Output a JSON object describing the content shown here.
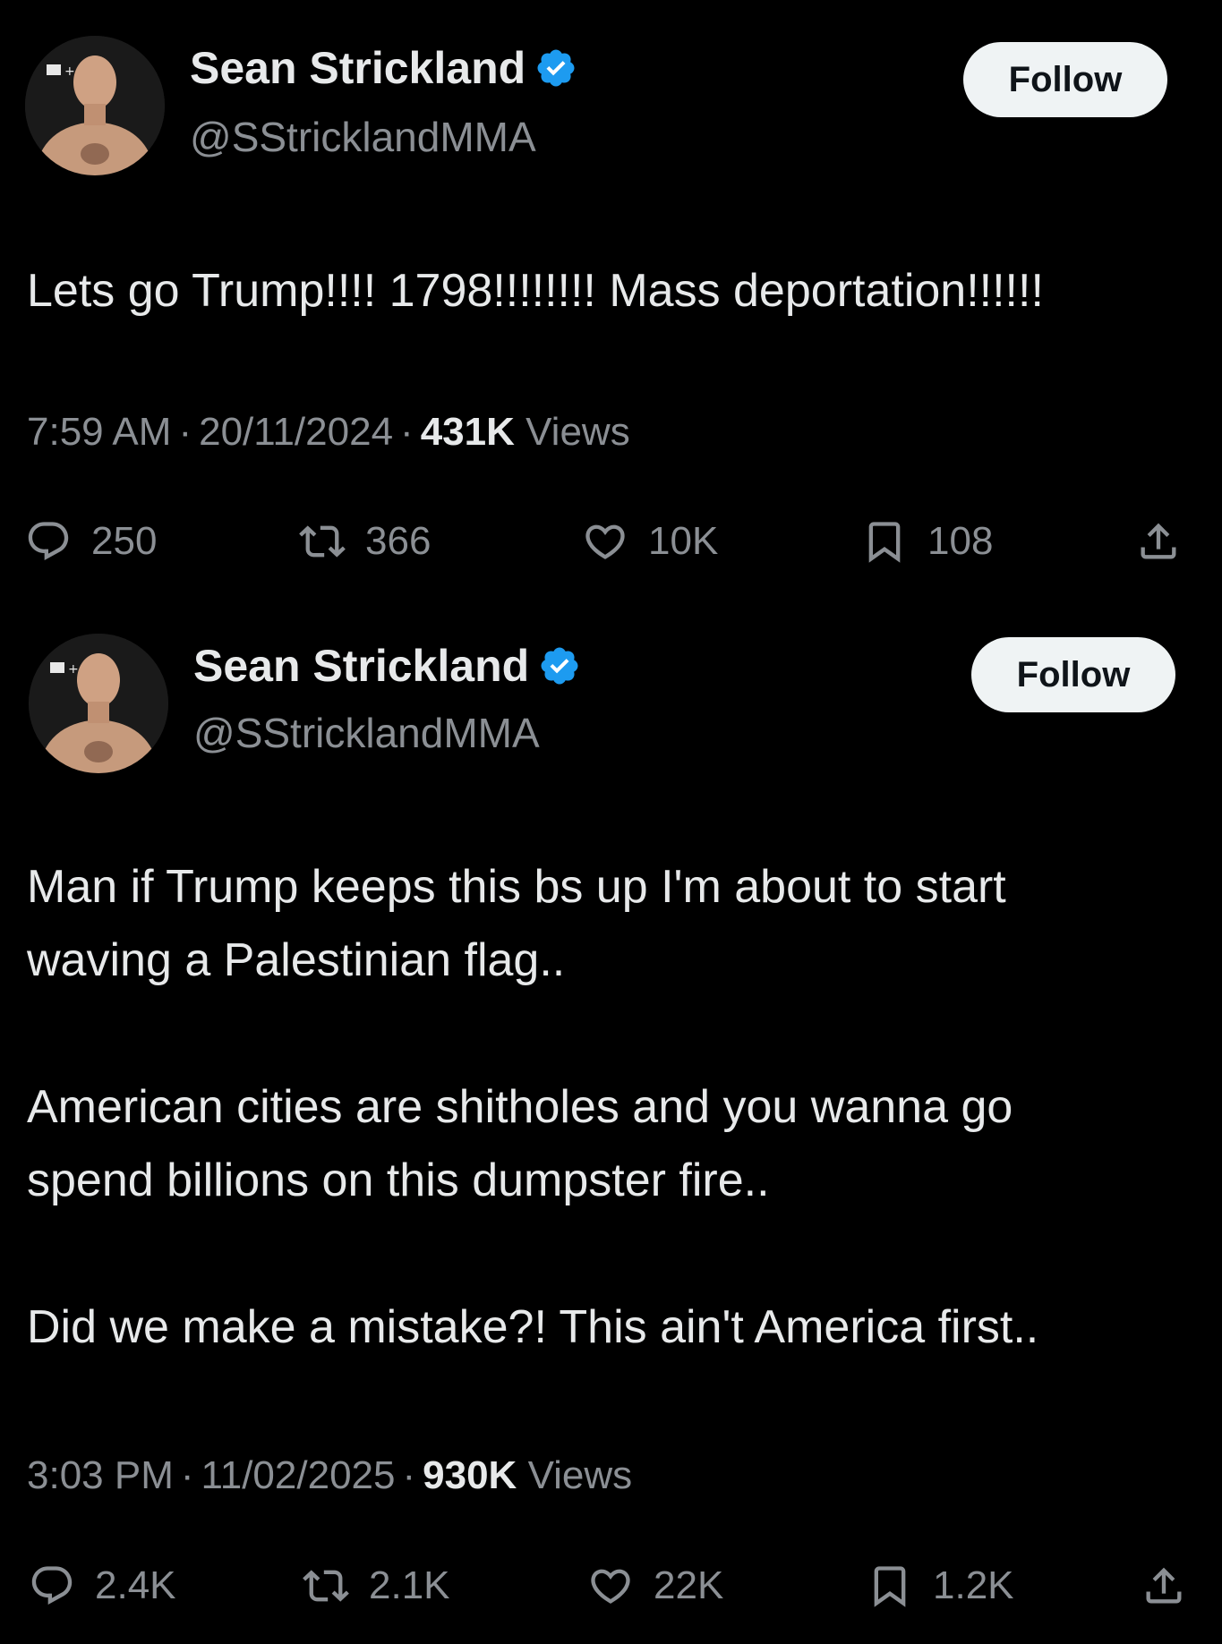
{
  "tweets": [
    {
      "author": {
        "display_name": "Sean Strickland",
        "handle": "@SStricklandMMA",
        "verified": true
      },
      "follow_label": "Follow",
      "text": [
        "Lets go Trump!!!! 1798!!!!!!!! Mass deportation!!!!!!"
      ],
      "meta": {
        "time": "7:59 AM",
        "date": "20/11/2024",
        "views_count": "431K",
        "views_label": "Views"
      },
      "stats": {
        "replies": "250",
        "reposts": "366",
        "likes": "10K",
        "bookmarks": "108"
      }
    },
    {
      "author": {
        "display_name": "Sean Strickland",
        "handle": "@SStricklandMMA",
        "verified": true
      },
      "follow_label": "Follow",
      "text": [
        "Man if Trump keeps this bs up I'm about to start",
        "waving a Palestinian flag..",
        "",
        "American cities are shitholes and you wanna go",
        "spend billions on this dumpster fire..",
        "",
        "Did we make a mistake?! This ain't America first.."
      ],
      "meta": {
        "time": "3:03 PM",
        "date": "11/02/2025",
        "views_count": "930K",
        "views_label": "Views"
      },
      "stats": {
        "replies": "2.4K",
        "reposts": "2.1K",
        "likes": "22K",
        "bookmarks": "1.2K"
      }
    }
  ],
  "colors": {
    "background": "#000000",
    "text": "#e7e9ea",
    "secondary": "#8b8f94",
    "verified": "#1d9bf0",
    "button_bg": "#eff3f4"
  },
  "icons": [
    "reply-icon",
    "repost-icon",
    "like-icon",
    "bookmark-icon",
    "share-icon",
    "verified-badge-icon"
  ]
}
